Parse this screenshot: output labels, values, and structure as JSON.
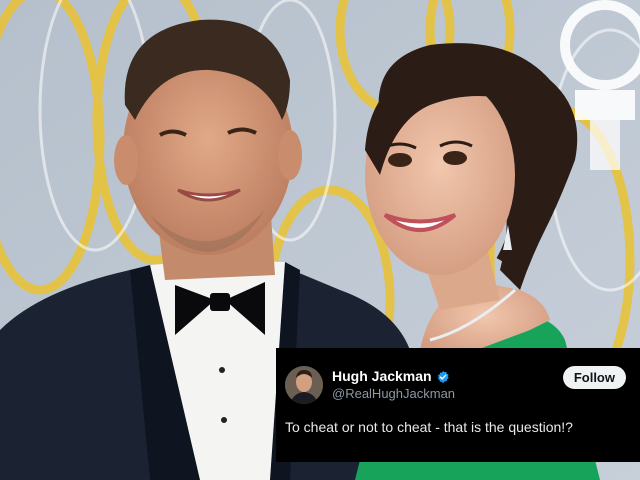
{
  "tweet": {
    "display_name": "Hugh Jackman",
    "handle": "@RealHughJackman",
    "follow_label": "Follow",
    "text": "To cheat or not to cheat - that is the question!?",
    "verified_icon": "verified-badge-icon",
    "avatar_icon": "profile-avatar"
  },
  "colors": {
    "card_bg": "#000000",
    "verified_blue": "#1d9bf0",
    "follow_bg": "#eff3f4",
    "handle_gray": "#8b98a5",
    "dress_green": "#1aa35a",
    "backdrop_yellow": "#e8c23a"
  }
}
